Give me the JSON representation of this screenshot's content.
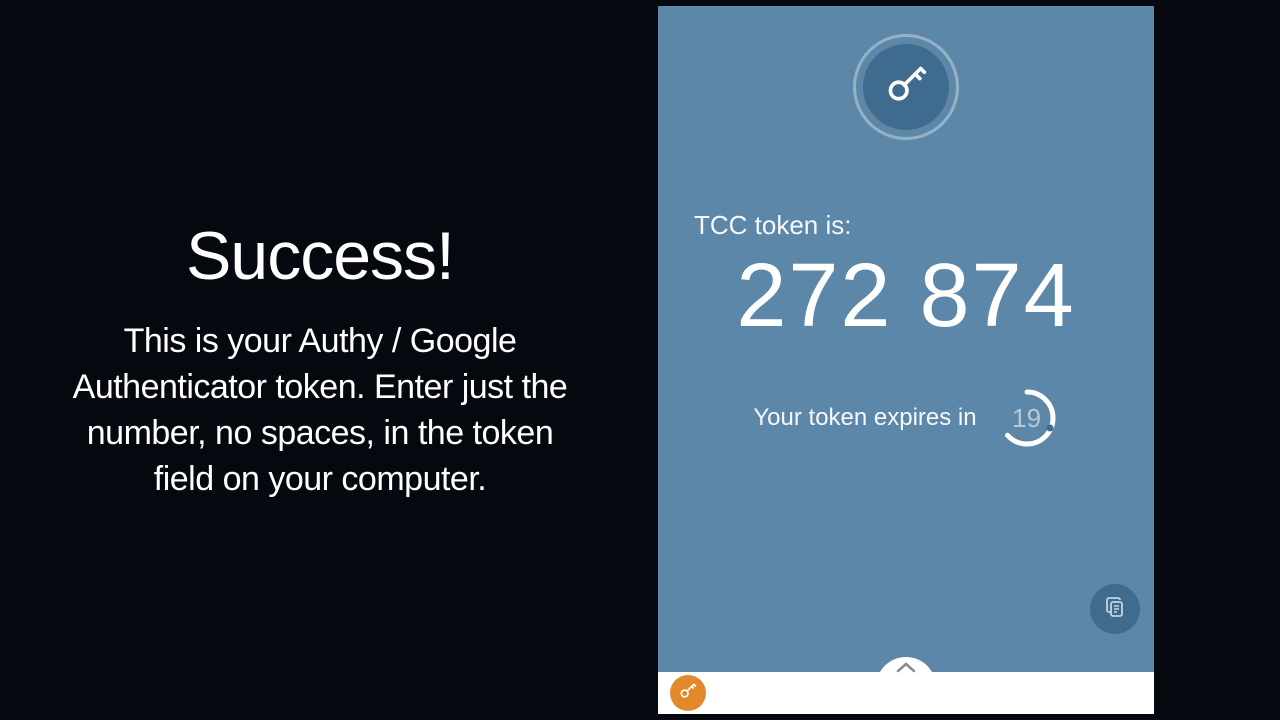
{
  "left": {
    "heading": "Success!",
    "body": "This is your Authy / Google Authenticator token.  Enter just the number, no spaces, in the token field on your computer."
  },
  "phone": {
    "token_label": "TCC token is:",
    "token_value": "272 874",
    "expires_label": "Your token expires in",
    "countdown_seconds": "19"
  },
  "colors": {
    "accent": "#5d87a8",
    "accent_dark": "#3f6b8f",
    "orange": "#e28a2b"
  }
}
